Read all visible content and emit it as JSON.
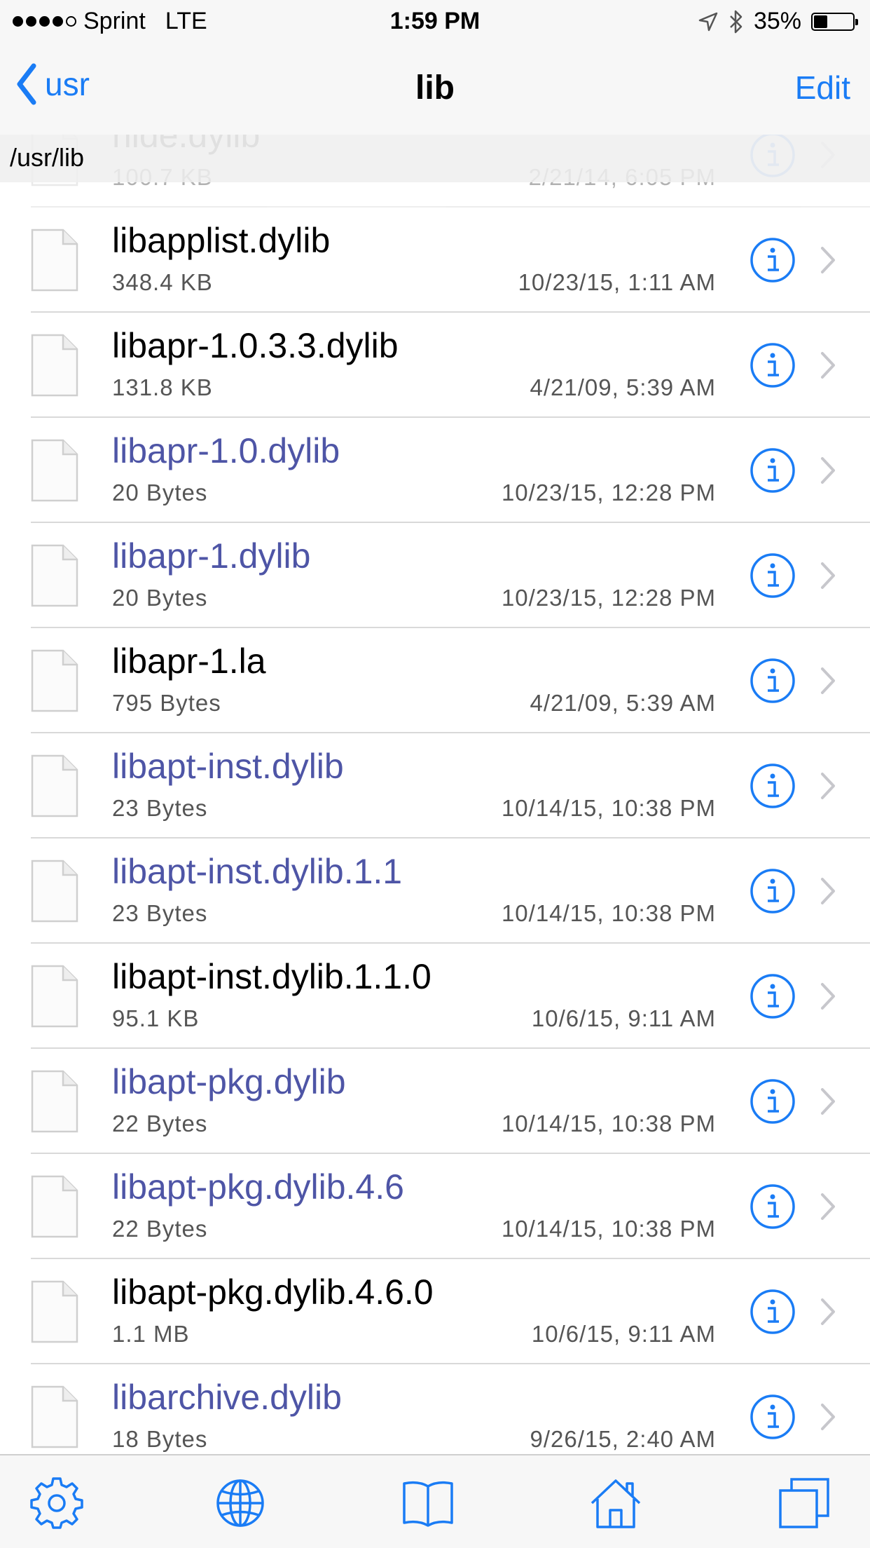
{
  "status_bar": {
    "carrier": "Sprint",
    "network": "LTE",
    "time": "1:59 PM",
    "battery_text": "35%",
    "battery_level": 0.35,
    "icons": [
      "signal-dots",
      "location-arrow-icon",
      "bluetooth-icon",
      "battery-icon"
    ]
  },
  "nav": {
    "back_label": "usr",
    "title": "lib",
    "edit_label": "Edit"
  },
  "path": "/usr/lib",
  "colors": {
    "accent": "#1a7cf5",
    "link_file": "#4e55a6",
    "text_secondary": "#555555"
  },
  "files": [
    {
      "name": "nide.dylib",
      "size": "100.7 KB",
      "date": "2/21/14, 6:05 PM",
      "symlink": false
    },
    {
      "name": "libapplist.dylib",
      "size": "348.4 KB",
      "date": "10/23/15, 1:11 AM",
      "symlink": false
    },
    {
      "name": "libapr-1.0.3.3.dylib",
      "size": "131.8 KB",
      "date": "4/21/09, 5:39 AM",
      "symlink": false
    },
    {
      "name": "libapr-1.0.dylib",
      "size": "20 Bytes",
      "date": "10/23/15, 12:28 PM",
      "symlink": true
    },
    {
      "name": "libapr-1.dylib",
      "size": "20 Bytes",
      "date": "10/23/15, 12:28 PM",
      "symlink": true
    },
    {
      "name": "libapr-1.la",
      "size": "795 Bytes",
      "date": "4/21/09, 5:39 AM",
      "symlink": false
    },
    {
      "name": "libapt-inst.dylib",
      "size": "23 Bytes",
      "date": "10/14/15, 10:38 PM",
      "symlink": true
    },
    {
      "name": "libapt-inst.dylib.1.1",
      "size": "23 Bytes",
      "date": "10/14/15, 10:38 PM",
      "symlink": true
    },
    {
      "name": "libapt-inst.dylib.1.1.0",
      "size": "95.1 KB",
      "date": "10/6/15, 9:11 AM",
      "symlink": false
    },
    {
      "name": "libapt-pkg.dylib",
      "size": "22 Bytes",
      "date": "10/14/15, 10:38 PM",
      "symlink": true
    },
    {
      "name": "libapt-pkg.dylib.4.6",
      "size": "22 Bytes",
      "date": "10/14/15, 10:38 PM",
      "symlink": true
    },
    {
      "name": "libapt-pkg.dylib.4.6.0",
      "size": "1.1 MB",
      "date": "10/6/15, 9:11 AM",
      "symlink": false
    },
    {
      "name": "libarchive.dylib",
      "size": "18 Bytes",
      "date": "9/26/15, 2:40 AM",
      "symlink": true
    }
  ],
  "tabs": [
    {
      "icon": "gear-icon"
    },
    {
      "icon": "globe-icon"
    },
    {
      "icon": "book-icon"
    },
    {
      "icon": "home-icon"
    },
    {
      "icon": "windows-icon"
    }
  ]
}
